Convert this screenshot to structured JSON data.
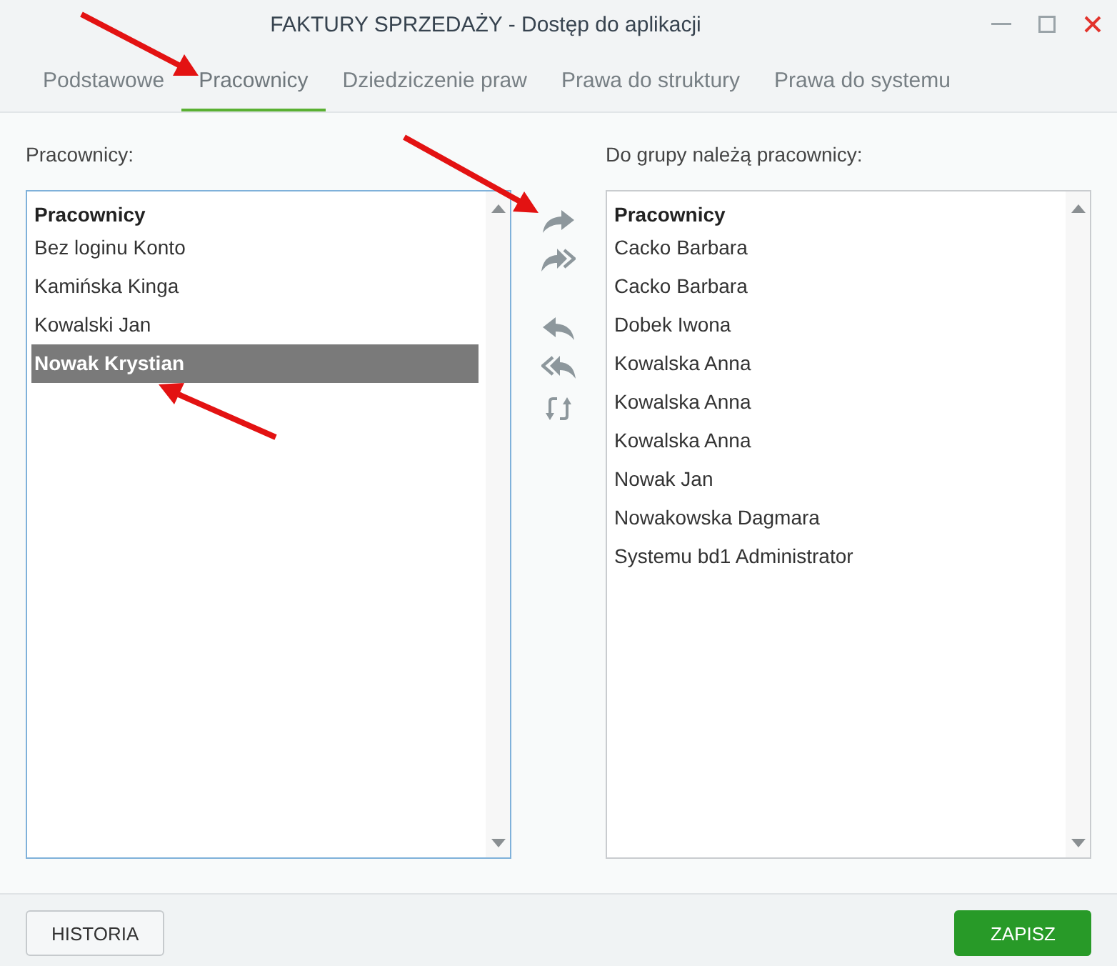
{
  "window": {
    "title": "FAKTURY SPRZEDAŻY - Dostęp do aplikacji"
  },
  "tabs": [
    {
      "label": "Podstawowe",
      "selected": false
    },
    {
      "label": "Pracownicy",
      "selected": true
    },
    {
      "label": "Dziedziczenie praw",
      "selected": false
    },
    {
      "label": "Prawa do struktury",
      "selected": false
    },
    {
      "label": "Prawa do systemu",
      "selected": false
    }
  ],
  "available": {
    "label": "Pracownicy:",
    "header": "Pracownicy",
    "focused": true,
    "items": [
      {
        "name": "Bez loginu Konto",
        "selected": false
      },
      {
        "name": "Kamińska Kinga",
        "selected": false
      },
      {
        "name": "Kowalski Jan",
        "selected": false
      },
      {
        "name": "Nowak Krystian",
        "selected": true
      }
    ]
  },
  "members": {
    "label": "Do grupy należą pracownicy:",
    "header": "Pracownicy",
    "focused": false,
    "items": [
      {
        "name": "Cacko Barbara",
        "selected": false
      },
      {
        "name": "Cacko Barbara",
        "selected": false
      },
      {
        "name": "Dobek Iwona",
        "selected": false
      },
      {
        "name": "Kowalska Anna",
        "selected": false
      },
      {
        "name": "Kowalska Anna",
        "selected": false
      },
      {
        "name": "Kowalska Anna",
        "selected": false
      },
      {
        "name": "Nowak Jan",
        "selected": false
      },
      {
        "name": "Nowakowska Dagmara",
        "selected": false
      },
      {
        "name": "Systemu bd1 Administrator",
        "selected": false
      }
    ]
  },
  "footer": {
    "buttons": [
      {
        "label": "HISTORIA",
        "kind": "secondary"
      },
      {
        "label": "ZAPISZ",
        "kind": "primary"
      }
    ]
  }
}
